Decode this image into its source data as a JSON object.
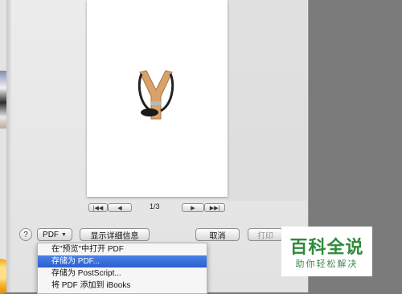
{
  "pager": {
    "first_icon": "skip-back-icon",
    "prev_icon": "play-back-icon",
    "page_indicator": "1/3",
    "next_icon": "play-forward-icon",
    "last_icon": "skip-forward-icon"
  },
  "controls": {
    "help_label": "?",
    "pdf_label": "PDF",
    "details_label": "显示详细信息",
    "cancel_label": "取消",
    "print_label": "打印"
  },
  "pdf_menu": {
    "items": [
      {
        "label": "在\"预览\"中打开 PDF"
      },
      {
        "label": "存储为 PDF..."
      },
      {
        "label": "存储为 PostScript..."
      },
      {
        "label": "将 PDF 添加到 iBooks"
      }
    ],
    "selected_index": 1
  },
  "watermark": {
    "title": "百科全说",
    "subtitle": "助你轻松解决"
  },
  "colors": {
    "menu_highlight": "#2a5fd0",
    "watermark_green": "#2f8a3a"
  }
}
